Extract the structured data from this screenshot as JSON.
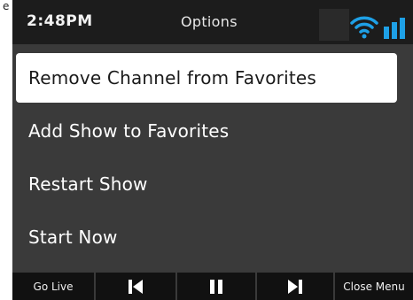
{
  "stray_char": "e",
  "status_bar": {
    "time": "2:48PM",
    "title": "Options"
  },
  "menu": {
    "items": [
      {
        "label": "Remove Channel from Favorites",
        "selected": true
      },
      {
        "label": "Add Show to Favorites",
        "selected": false
      },
      {
        "label": "Restart Show",
        "selected": false
      },
      {
        "label": "Start Now",
        "selected": false
      }
    ]
  },
  "bottom_bar": {
    "go_live_label": "Go Live",
    "close_menu_label": "Close Menu",
    "icons": [
      "skip-back-icon",
      "pause-icon",
      "skip-forward-icon"
    ]
  },
  "colors": {
    "status_bar_bg": "#1c1c1c",
    "menu_bg": "#3a3a3a",
    "selected_bg": "#ffffff",
    "wifi_accent": "#1ea0e6"
  }
}
